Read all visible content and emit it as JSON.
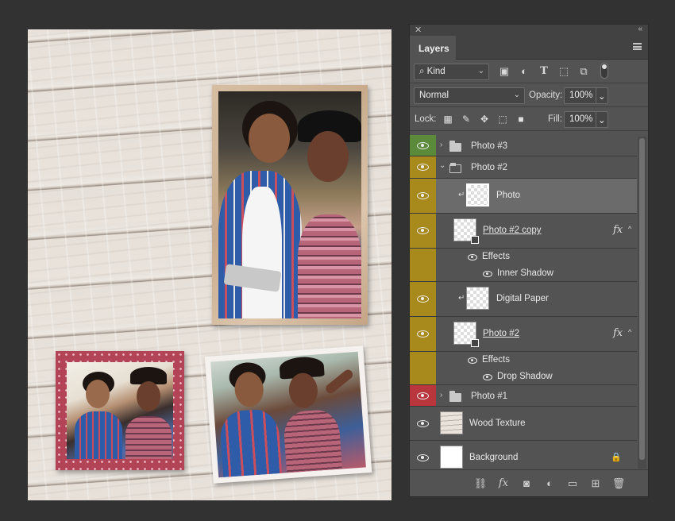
{
  "panel": {
    "close_glyph": "✕",
    "collapse_glyph": "«",
    "tab_label": "Layers",
    "filter": {
      "kind_label": "Kind",
      "kind_glyph": "⌕"
    },
    "blend": {
      "mode": "Normal",
      "opacity_label": "Opacity:",
      "opacity_value": "100%"
    },
    "lock": {
      "label": "Lock:",
      "fill_label": "Fill:",
      "fill_value": "100%"
    }
  },
  "layers": [
    {
      "name": "Photo #3",
      "type": "group",
      "expanded": false,
      "color": "#5b8a3a"
    },
    {
      "name": "Photo #2",
      "type": "group",
      "expanded": true,
      "color": "#a8891c"
    },
    {
      "name": "Photo",
      "type": "smart",
      "clipped": true,
      "selected": true,
      "color": "#a8891c"
    },
    {
      "name": "Photo #2 copy",
      "type": "layer",
      "fx": true,
      "color": "#a8891c"
    },
    {
      "name": "Effects",
      "type": "effects-header",
      "color": "#a8891c"
    },
    {
      "name": "Inner Shadow",
      "type": "effect",
      "color": "#a8891c"
    },
    {
      "name": "Digital Paper",
      "type": "layer",
      "clipped": true,
      "color": "#a8891c"
    },
    {
      "name": "Photo #2",
      "type": "layer",
      "fx": true,
      "color": "#a8891c"
    },
    {
      "name": "Effects",
      "type": "effects-header",
      "color": "#a8891c"
    },
    {
      "name": "Drop Shadow",
      "type": "effect",
      "color": "#a8891c"
    },
    {
      "name": "Photo #1",
      "type": "group",
      "expanded": false,
      "color": "#b9363d"
    },
    {
      "name": "Wood Texture",
      "type": "layer",
      "color": ""
    },
    {
      "name": "Background",
      "type": "background",
      "locked": true,
      "color": ""
    }
  ],
  "glyphs": {
    "fx": "fx",
    "clip_arrow": "↵",
    "expand_right": "›",
    "expand_down": "⌄",
    "chevron_up": "^",
    "lock": "🔒",
    "dropdown": "⌄"
  },
  "footer_icons": [
    "link-icon",
    "fx-icon",
    "mask-icon",
    "adjustment-icon",
    "group-icon",
    "new-layer-icon",
    "trash-icon"
  ]
}
